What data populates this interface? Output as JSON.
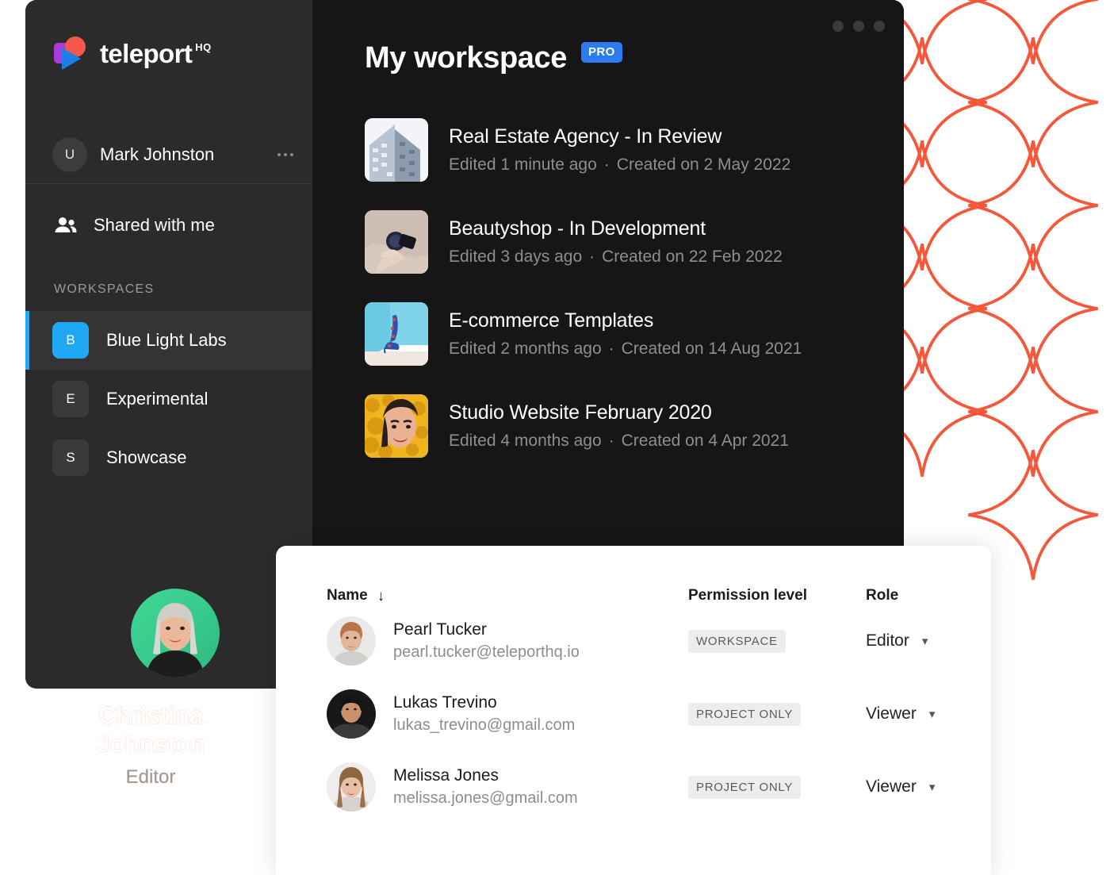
{
  "brand": {
    "name": "teleport",
    "suffix": "HQ",
    "logo_icon": "teleport-logo-icon"
  },
  "sidebar": {
    "user": {
      "initial": "U",
      "name": "Mark Johnston",
      "menu_icon": "more-dots-icon"
    },
    "nav": [
      {
        "label": "Shared with me",
        "icon": "people-icon"
      }
    ],
    "section_label": "WORKSPACES",
    "workspaces": [
      {
        "badge": "B",
        "label": "Blue Light Labs",
        "active": true,
        "color": "#21a8f5"
      },
      {
        "badge": "E",
        "label": "Experimental",
        "active": false,
        "color": "#3a3a3a"
      },
      {
        "badge": "S",
        "label": "Showcase",
        "active": false,
        "color": "#3a3a3a"
      }
    ]
  },
  "header": {
    "title": "My workspace",
    "badge": "PRO",
    "window_dots_icon": "window-controls-icon"
  },
  "projects": [
    {
      "thumb": "building-photo",
      "title": "Real Estate Agency - In Review",
      "edited": "Edited 1 minute ago",
      "created": "Created on 2 May 2022"
    },
    {
      "thumb": "cosmetics-photo",
      "title": "Beautyshop - In Development",
      "edited": "Edited 3 days ago",
      "created": "Created on 22 Feb 2022"
    },
    {
      "thumb": "shoe-photo",
      "title": "E-commerce Templates",
      "edited": "Edited 2 months ago",
      "created": "Created on 14 Aug 2021"
    },
    {
      "thumb": "portrait-yellow-photo",
      "title": "Studio Website February 2020",
      "edited": "Edited 4 months ago",
      "created": "Created on 4 Apr 2021"
    }
  ],
  "members_table": {
    "columns": {
      "name": "Name",
      "permission": "Permission level",
      "role": "Role",
      "sort_icon": "arrow-down-icon"
    },
    "rows": [
      {
        "avatar": "avatar-pearl",
        "name": "Pearl Tucker",
        "email": "pearl.tucker@teleporthq.io",
        "permission": "WORKSPACE",
        "role": "Editor",
        "chevron": "chevron-down-icon"
      },
      {
        "avatar": "avatar-lukas",
        "name": "Lukas Trevino",
        "email": "lukas_trevino@gmail.com",
        "permission": "PROJECT ONLY",
        "role": "Viewer",
        "chevron": "chevron-down-icon"
      },
      {
        "avatar": "avatar-melissa",
        "name": "Melissa Jones",
        "email": "melissa.jones@gmail.com",
        "permission": "PROJECT ONLY",
        "role": "Viewer",
        "chevron": "chevron-down-icon"
      }
    ]
  },
  "profile_caption": {
    "name": "Christina Johnston",
    "role": "Editor",
    "photo": "avatar-christina"
  },
  "decor": {
    "star_icon": "four-point-star-icon",
    "star_color": "#f4573a"
  },
  "colors": {
    "accent_blue": "#2b7cf0",
    "active_blue": "#21a8f5",
    "panel_dark": "#161616",
    "sidebar_dark": "#2b2b2b",
    "star_orange": "#f4573a"
  }
}
